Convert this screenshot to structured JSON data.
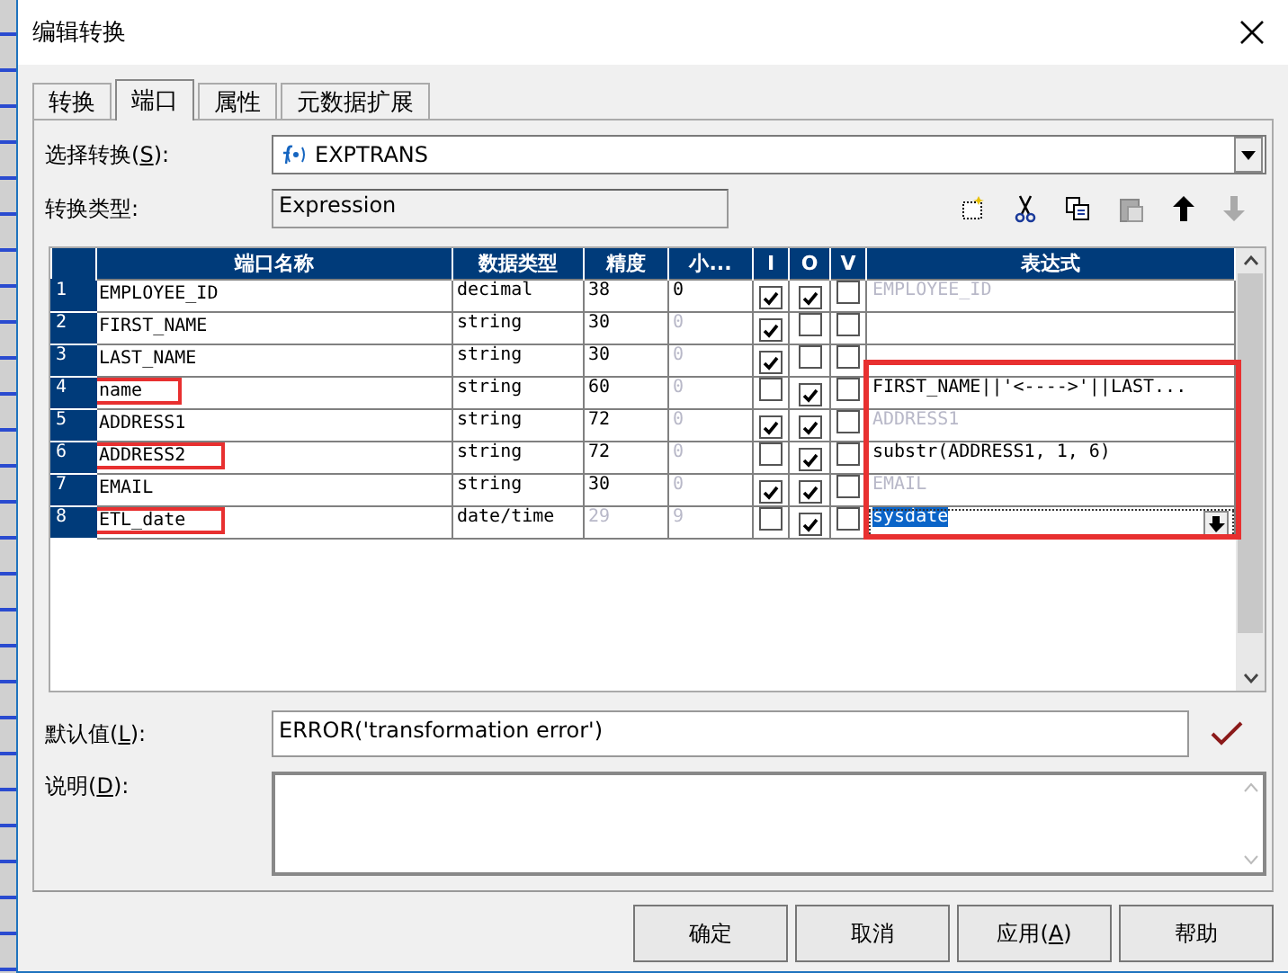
{
  "window": {
    "title": "编辑转换"
  },
  "tabs": [
    {
      "label": "转换",
      "selected": false
    },
    {
      "label": "端口",
      "selected": true
    },
    {
      "label": "属性",
      "selected": false
    },
    {
      "label": "元数据扩展",
      "selected": false
    }
  ],
  "select_transformation": {
    "label": "选择转换(S):",
    "value": "EXPTRANS"
  },
  "transformation_type": {
    "label": "转换类型:",
    "value": "Expression"
  },
  "table": {
    "columns": [
      "端口名称",
      "数据类型",
      "精度",
      "小...",
      "I",
      "O",
      "V",
      "表达式"
    ],
    "rows": [
      {
        "number": "1",
        "name": "EMPLOYEE_ID",
        "datatype": "decimal",
        "precision": "38",
        "precision_disabled": false,
        "scale": "0",
        "scale_disabled": false,
        "input": true,
        "output": true,
        "variable": false,
        "expression": "EMPLOYEE_ID",
        "expression_disabled": true,
        "highlighted": false,
        "selected": false
      },
      {
        "number": "2",
        "name": "FIRST_NAME",
        "datatype": "string",
        "precision": "30",
        "precision_disabled": false,
        "scale": "0",
        "scale_disabled": true,
        "input": true,
        "output": false,
        "variable": false,
        "highlighted": false,
        "selected": false
      },
      {
        "number": "3",
        "name": "LAST_NAME",
        "datatype": "string",
        "precision": "30",
        "precision_disabled": false,
        "scale": "0",
        "scale_disabled": true,
        "input": true,
        "output": false,
        "variable": false,
        "highlighted": false,
        "selected": false
      },
      {
        "number": "4",
        "name": "name",
        "datatype": "string",
        "precision": "60",
        "precision_disabled": false,
        "scale": "0",
        "scale_disabled": true,
        "input": false,
        "output": true,
        "variable": false,
        "expression": "FIRST_NAME||'<---->'||LAST...",
        "expression_disabled": false,
        "highlighted": true,
        "selected": false
      },
      {
        "number": "5",
        "name": "ADDRESS1",
        "datatype": "string",
        "precision": "72",
        "precision_disabled": false,
        "scale": "0",
        "scale_disabled": true,
        "input": true,
        "output": true,
        "variable": false,
        "expression": "ADDRESS1",
        "expression_disabled": true,
        "highlighted": false,
        "selected": false
      },
      {
        "number": "6",
        "name": "ADDRESS2",
        "datatype": "string",
        "precision": "72",
        "precision_disabled": false,
        "scale": "0",
        "scale_disabled": true,
        "input": false,
        "output": true,
        "variable": false,
        "expression": "substr(ADDRESS1, 1, 6)",
        "expression_disabled": false,
        "highlighted": true,
        "selected": false
      },
      {
        "number": "7",
        "name": "EMAIL",
        "datatype": "string",
        "precision": "30",
        "precision_disabled": false,
        "scale": "0",
        "scale_disabled": true,
        "input": true,
        "output": true,
        "variable": false,
        "expression": "EMAIL",
        "expression_disabled": true,
        "highlighted": false,
        "selected": false
      },
      {
        "number": "8",
        "name": "ETL_date",
        "datatype": "date/time",
        "precision": "29",
        "precision_disabled": true,
        "scale": "9",
        "scale_disabled": true,
        "input": false,
        "output": true,
        "variable": false,
        "expression": "sysdate",
        "expression_disabled": false,
        "highlighted": true,
        "selected": true
      }
    ],
    "expressions_highlighted": true
  },
  "default_value": {
    "label": "默认值(L):",
    "value": "ERROR('transformation error')"
  },
  "description": {
    "label": "说明(D):"
  },
  "buttons": [
    {
      "label": "确定"
    },
    {
      "label": "取消"
    },
    {
      "label": "应用(A)"
    },
    {
      "label": "帮助"
    }
  ]
}
